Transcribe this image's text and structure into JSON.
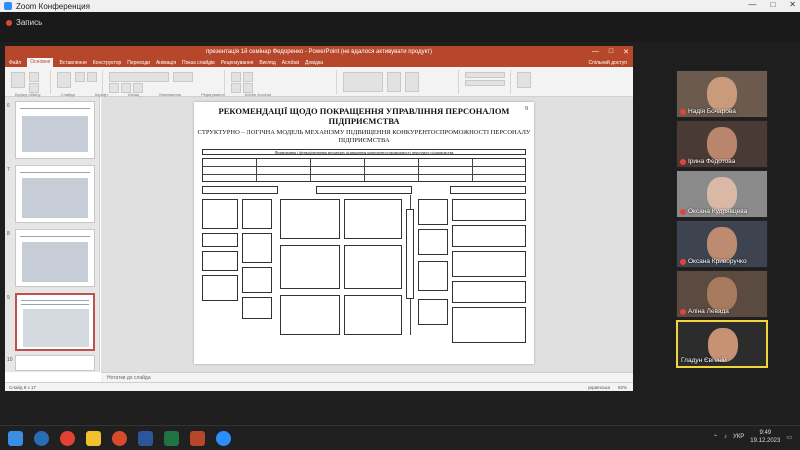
{
  "zoom": {
    "window_title": "Zoom Конференция",
    "recording_label": "Запись",
    "window_controls": [
      "—",
      "□",
      "✕"
    ]
  },
  "powerpoint": {
    "title": "презентація 1й семінар Федоренко - PowerPoint (не вдалося активувати продукт)",
    "tabs": [
      "Файл",
      "Основне",
      "Вставлення",
      "Конструктор",
      "Переходи",
      "Анімація",
      "Показ слайдів",
      "Рецензування",
      "Вигляд",
      "Acrobat",
      "Довідка"
    ],
    "active_tab": "Основне",
    "ribbon_groups": [
      "Буфер обміну",
      "Слайди",
      "Шрифт",
      "Абзац",
      "Малювання",
      "Редагування",
      "Adobe Acrobat"
    ],
    "share_label": "Спільний доступ",
    "notes_placeholder": "Нотатки до слайда",
    "status_left": "Слайд 9 з 17",
    "status_lang": "українська",
    "zoom_level": "92%",
    "thumbnail_numbers": [
      "6",
      "7",
      "8",
      "9",
      "10"
    ],
    "selected_slide": "9"
  },
  "slide": {
    "number": "9",
    "title": "РЕКОМЕНДАЦІЇ ЩОДО ПОКРАЩЕННЯ УПРАВЛІННЯ ПЕРСОНАЛОМ ПІДПРИЄМСТВА",
    "subtitle": "СТРУКТУРНО – ЛОГІЧНА МОДЕЛЬ МЕХАНІЗМУ ПІДВИЩЕННЯ КОНКУРЕНТОСПРОМОЖНОСТІ ПЕРСОНАЛУ ПІДПРИЄМСТВА",
    "diagram_header": "Формування і функціонування механізму підвищення конкурентоспроможності персоналу підприємства"
  },
  "participants": [
    {
      "name": "Надія Бочарова",
      "muted": true,
      "skin": "#c99a7c",
      "bg": "#6b5a4d"
    },
    {
      "name": "Ірина Федотова",
      "muted": true,
      "skin": "#b9856d",
      "bg": "#4a3a35"
    },
    {
      "name": "Оксана Кудрявцева",
      "muted": true,
      "skin": "#d9b8a6",
      "bg": "#8a8a8a"
    },
    {
      "name": "Оксана Криворучко",
      "muted": true,
      "skin": "#bd8b6f",
      "bg": "#3d4450"
    },
    {
      "name": "Аліна Левада",
      "muted": true,
      "skin": "#a77a5e",
      "bg": "#5a4a40"
    },
    {
      "name": "Гладун Євгеній",
      "muted": false,
      "skin": "#c79274",
      "bg": "#2c2c2c"
    }
  ],
  "taskbar": {
    "language": "УКР",
    "time": "9:49",
    "date": "19.12.2023"
  },
  "colors": {
    "powerpoint_accent": "#b7472a",
    "active_speaker": "#f0d53c",
    "record_red": "#e0443e"
  }
}
